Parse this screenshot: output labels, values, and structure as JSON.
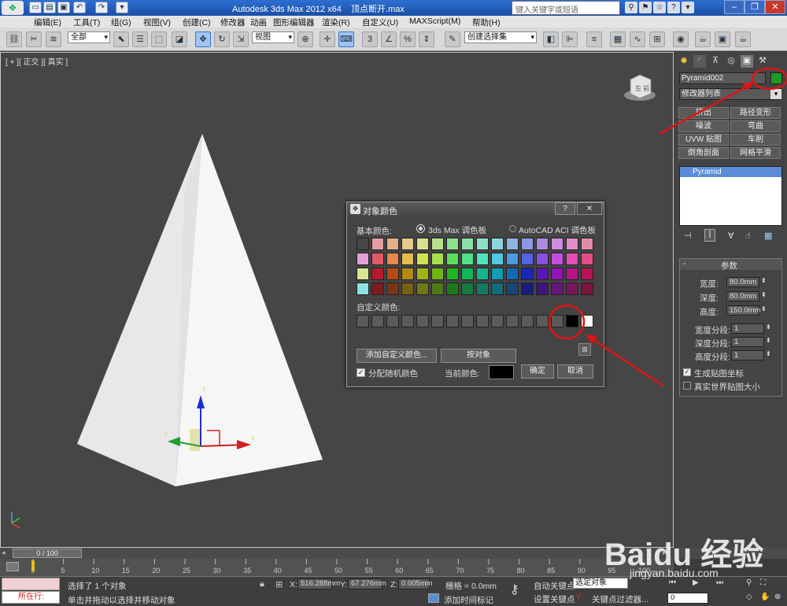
{
  "title_bar": {
    "app_title": "Autodesk 3ds Max  2012 x64",
    "file_name": "顶点断开.max",
    "search_placeholder": "键入关键字或短语"
  },
  "menu": [
    "编辑(E)",
    "工具(T)",
    "组(G)",
    "视图(V)",
    "创建(C)",
    "修改器",
    "动画",
    "图形编辑器",
    "渲染(R)",
    "自定义(U)",
    "MAXScript(M)",
    "帮助(H)"
  ],
  "toolbar": {
    "selection_filter": "全部",
    "reference_coord": "视图",
    "named_selection": "创建选择集"
  },
  "viewport": {
    "label": "[ + ][ 正交 ][ 真实 ]",
    "viewcube_label": "左 前"
  },
  "dialog": {
    "title": "对象颜色",
    "help": "?",
    "close": "✕",
    "basic_colors_label": "基本颜色:",
    "palette_3ds": "3ds Max 调色板",
    "palette_acad": "AutoCAD ACI 调色板",
    "custom_colors_label": "自定义颜色:",
    "add_custom_button": "添加自定义颜色...",
    "by_object_button": "按对象",
    "assign_random_label": "分配随机颜色",
    "current_color_label": "当前颜色:",
    "current_color": "#000000",
    "ok_button": "确定",
    "cancel_button": "取消",
    "basic_palette": [
      [
        "#464646",
        "#e39da2",
        "#e2b18c",
        "#e3c98c",
        "#d9e08c",
        "#b9e08c",
        "#90df8d",
        "#8de0a8",
        "#8ce0c9",
        "#8cd5e0",
        "#8cb6e0",
        "#8f97e3",
        "#ab8ce0",
        "#cf8ce0",
        "#e08cc6",
        "#e08ca8"
      ],
      [
        "#e6a0d6",
        "#e15b67",
        "#e5884d",
        "#e5bd4e",
        "#d1e04d",
        "#a3e04d",
        "#5ddc5a",
        "#4ee189",
        "#4ee2be",
        "#4ec9e2",
        "#4e98e2",
        "#5562e4",
        "#8b4ee2",
        "#c34ee2",
        "#e24eb4",
        "#e24e83"
      ],
      [
        "#d6e68f",
        "#b51b2b",
        "#b54a13",
        "#b58915",
        "#a2b514",
        "#6fb515",
        "#22b41c",
        "#14b558",
        "#15b58f",
        "#149db5",
        "#1469b5",
        "#1b26b6",
        "#5b14b5",
        "#9414b5",
        "#b51488",
        "#b51455"
      ],
      [
        "#8ee2e3",
        "#7a1c20",
        "#7a3516",
        "#7a5e16",
        "#6f7a16",
        "#4c7a16",
        "#1c7a18",
        "#167a3d",
        "#167a61",
        "#166b7a",
        "#16487a",
        "#191d7b",
        "#3f167a",
        "#65167a",
        "#7a165c",
        "#7a163b"
      ]
    ],
    "custom_palette": [
      "#5b5b5b",
      "#5b5b5b",
      "#5b5b5b",
      "#5b5b5b",
      "#5b5b5b",
      "#5b5b5b",
      "#5b5b5b",
      "#5b5b5b",
      "#5b5b5b",
      "#5b5b5b",
      "#5b5b5b",
      "#5b5b5b",
      "#5b5b5b",
      "#5b5b5b",
      "#000000",
      "#ffffff"
    ]
  },
  "command_panel": {
    "object_name": "Pyramid002",
    "object_color": "#1f9a24",
    "modifier_list": "修改器列表",
    "modifier_buttons": [
      "挤出",
      "路径变形",
      "噪波",
      "弯曲",
      "UVW 贴图",
      "车削",
      "倒角剖面",
      "网格平滑"
    ],
    "stack_item": "Pyramid",
    "rollout_title": "参数",
    "params": [
      {
        "label": "宽度:",
        "value": "80.0mm"
      },
      {
        "label": "深度:",
        "value": "80.0mm"
      },
      {
        "label": "高度:",
        "value": "150.0mm"
      }
    ],
    "segments": [
      {
        "label": "宽度分段:",
        "value": "1"
      },
      {
        "label": "深度分段:",
        "value": "1"
      },
      {
        "label": "高度分段:",
        "value": "1"
      }
    ],
    "gen_mapping": "生成贴图坐标",
    "real_world": "真实世界贴图大小"
  },
  "timeline": {
    "frame": "0 / 100",
    "ticks": [
      "0",
      "5",
      "10",
      "15",
      "20",
      "25",
      "30",
      "35",
      "40",
      "45",
      "50",
      "55",
      "60",
      "65",
      "70",
      "75",
      "80",
      "85",
      "90",
      "95",
      "100"
    ]
  },
  "status": {
    "mini_listener": "所在行:",
    "selected_text": "选择了 1 个对象",
    "prompt_text": "单击并拖动以选择并移动对象",
    "x_label": "X:",
    "x_value": "516.288mm",
    "y_label": "Y:",
    "y_value": "67.276mm",
    "z_label": "Z:",
    "z_value": "0.005mm",
    "grid": "栅格 = 0.0mm",
    "auto_key": "自动关键点",
    "selected_object": "选定对象",
    "set_key": "设置关键点",
    "key_filters": "关键点过滤器...",
    "add_time_tag": "添加时间标记",
    "frame_input": "0"
  },
  "watermark": "Baidu 经验",
  "watermark_url": "jingyan.baidu.com"
}
